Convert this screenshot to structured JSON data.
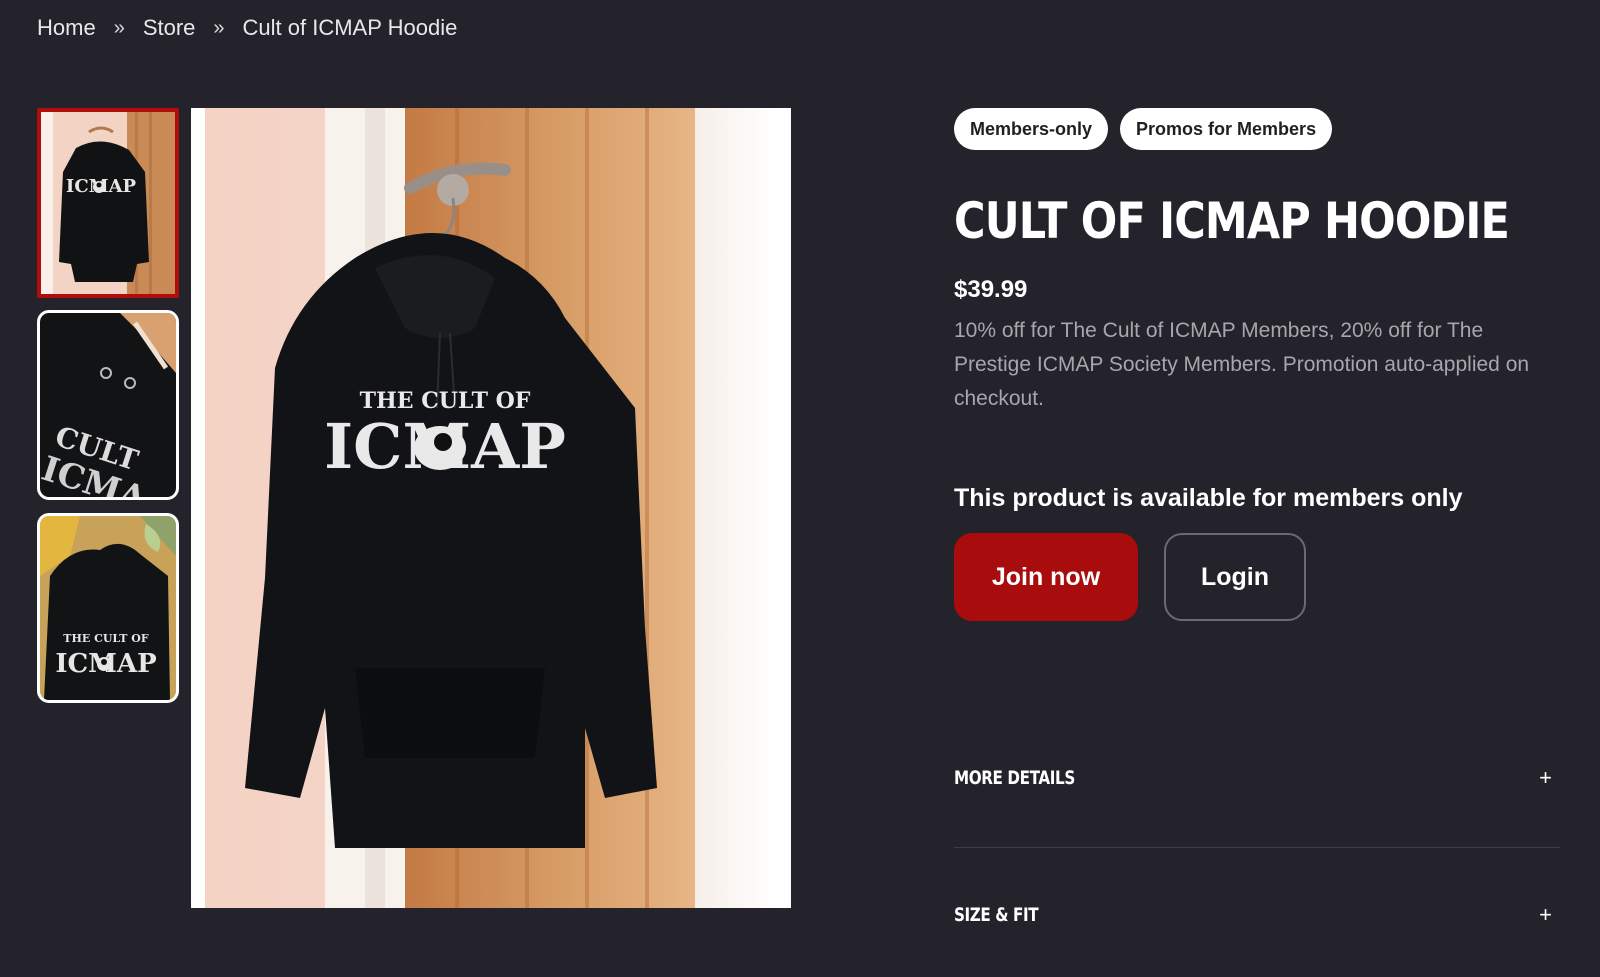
{
  "breadcrumb": {
    "items": [
      "Home",
      "Store",
      "Cult of ICMAP Hoodie"
    ],
    "separator": "»"
  },
  "product": {
    "tags": [
      "Members-only",
      "Promos for Members"
    ],
    "title": "CULT OF ICMAP HOODIE",
    "price": "$39.99",
    "promo": "10% off for The Cult of ICMAP Members, 20% off for The Prestige ICMAP Society Members. Promotion auto-applied on checkout.",
    "members_note": "This product is available for members only",
    "join_label": "Join now",
    "login_label": "Login"
  },
  "details": {
    "more_details": "MORE DETAILS",
    "size_fit": "SIZE & FIT",
    "expand_symbol": "+"
  },
  "colors": {
    "background": "#24232c",
    "accent": "#a80c0c",
    "muted_text": "#a7a6ac"
  }
}
